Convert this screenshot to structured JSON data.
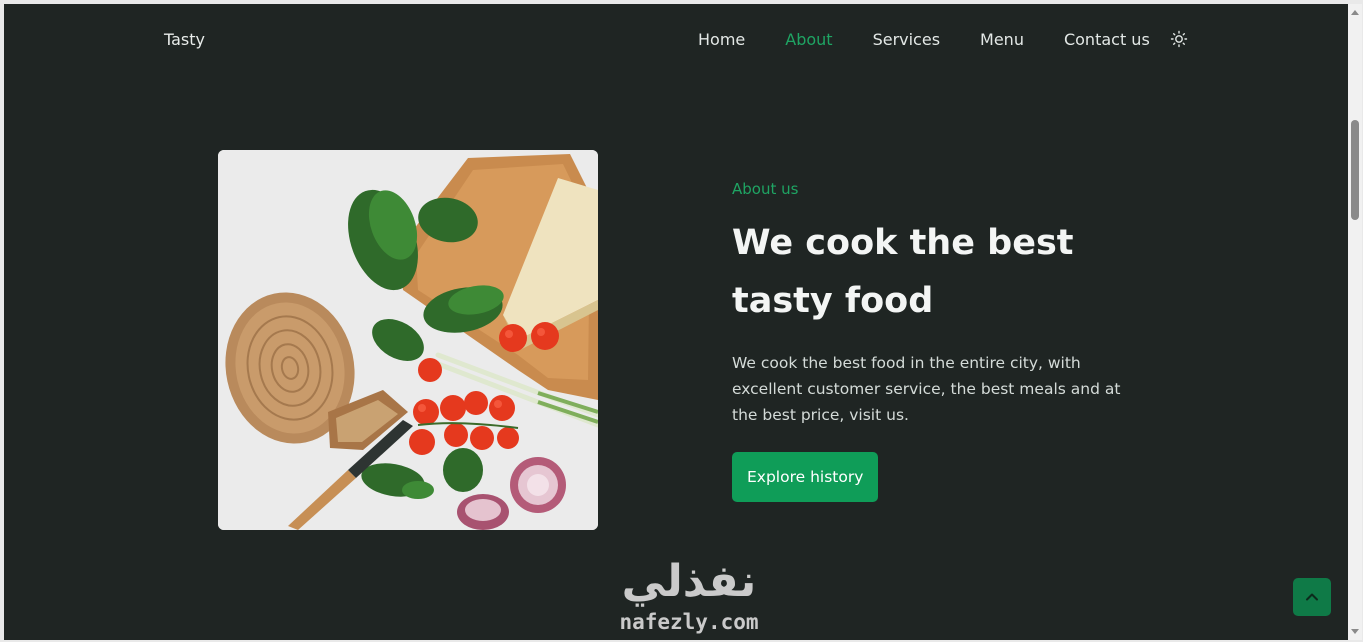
{
  "header": {
    "logo": "Tasty",
    "nav": [
      {
        "label": "Home"
      },
      {
        "label": "About"
      },
      {
        "label": "Services"
      },
      {
        "label": "Menu"
      },
      {
        "label": "Contact us"
      }
    ],
    "active_nav": "About",
    "theme_icon": "sun-icon"
  },
  "about": {
    "subtitle": "About us",
    "title_line1": "We cook the best",
    "title_line2": "tasty food",
    "description": "We cook the best food in the entire city, with excellent customer service, the best meals and at the best price, visit us.",
    "button": "Explore history"
  },
  "watermark": {
    "arabic": "نفذلي",
    "latin": "nafezly.com"
  },
  "scroll_top_icon": "chevron-up-icon",
  "colors": {
    "background": "#1f2523",
    "accent": "#1fa463",
    "button": "#0f9d58"
  }
}
